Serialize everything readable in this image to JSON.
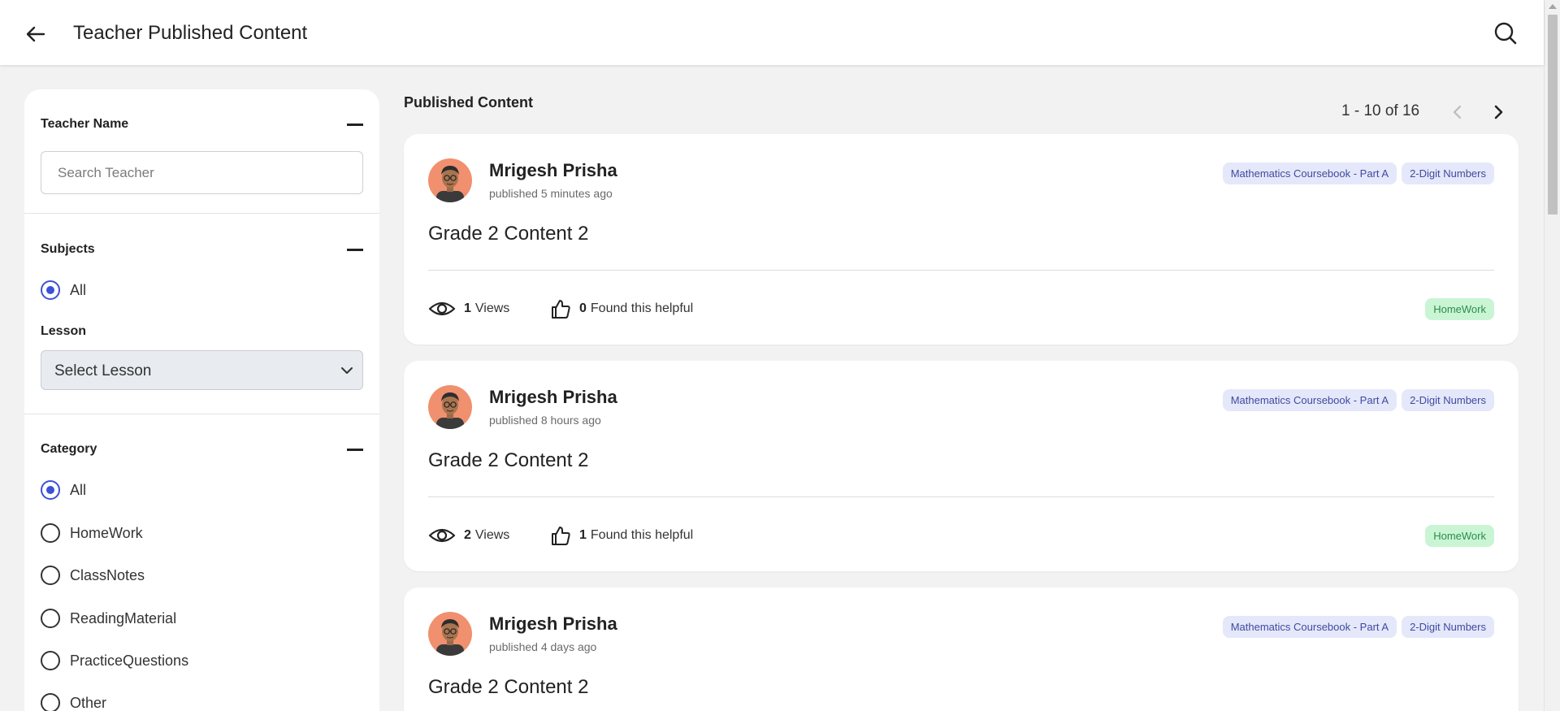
{
  "header": {
    "title": "Teacher Published Content"
  },
  "sidebar": {
    "teacher": {
      "title": "Teacher Name",
      "placeholder": "Search Teacher"
    },
    "subjects": {
      "title": "Subjects",
      "options": [
        "All"
      ]
    },
    "lesson": {
      "title": "Lesson",
      "selected": "Select Lesson"
    },
    "category": {
      "title": "Category",
      "options": [
        "All",
        "HomeWork",
        "ClassNotes",
        "ReadingMaterial",
        "PracticeQuestions",
        "Other"
      ]
    }
  },
  "main": {
    "title": "Published Content",
    "pager": "1 - 10 of 16",
    "cards": [
      {
        "author": "Mrigesh Prisha",
        "published": "published 5 minutes ago",
        "tags": [
          "Mathematics Coursebook - Part A",
          "2-Digit Numbers"
        ],
        "content_title": "Grade 2 Content 2",
        "views": "1",
        "views_label": "Views",
        "helpful": "0",
        "helpful_label": "Found this helpful",
        "category": "HomeWork"
      },
      {
        "author": "Mrigesh Prisha",
        "published": "published 8 hours ago",
        "tags": [
          "Mathematics Coursebook - Part A",
          "2-Digit Numbers"
        ],
        "content_title": "Grade 2 Content 2",
        "views": "2",
        "views_label": "Views",
        "helpful": "1",
        "helpful_label": "Found this helpful",
        "category": "HomeWork"
      },
      {
        "author": "Mrigesh Prisha",
        "published": "published 4 days ago",
        "tags": [
          "Mathematics Coursebook - Part A",
          "2-Digit Numbers"
        ],
        "content_title": "Grade 2 Content 2"
      }
    ]
  },
  "colors": {
    "accent": "#3a51d9",
    "avatar_bg": "#f0906e",
    "tag_bg": "#e5e8fa",
    "badge_bg": "#c9f5d5"
  }
}
